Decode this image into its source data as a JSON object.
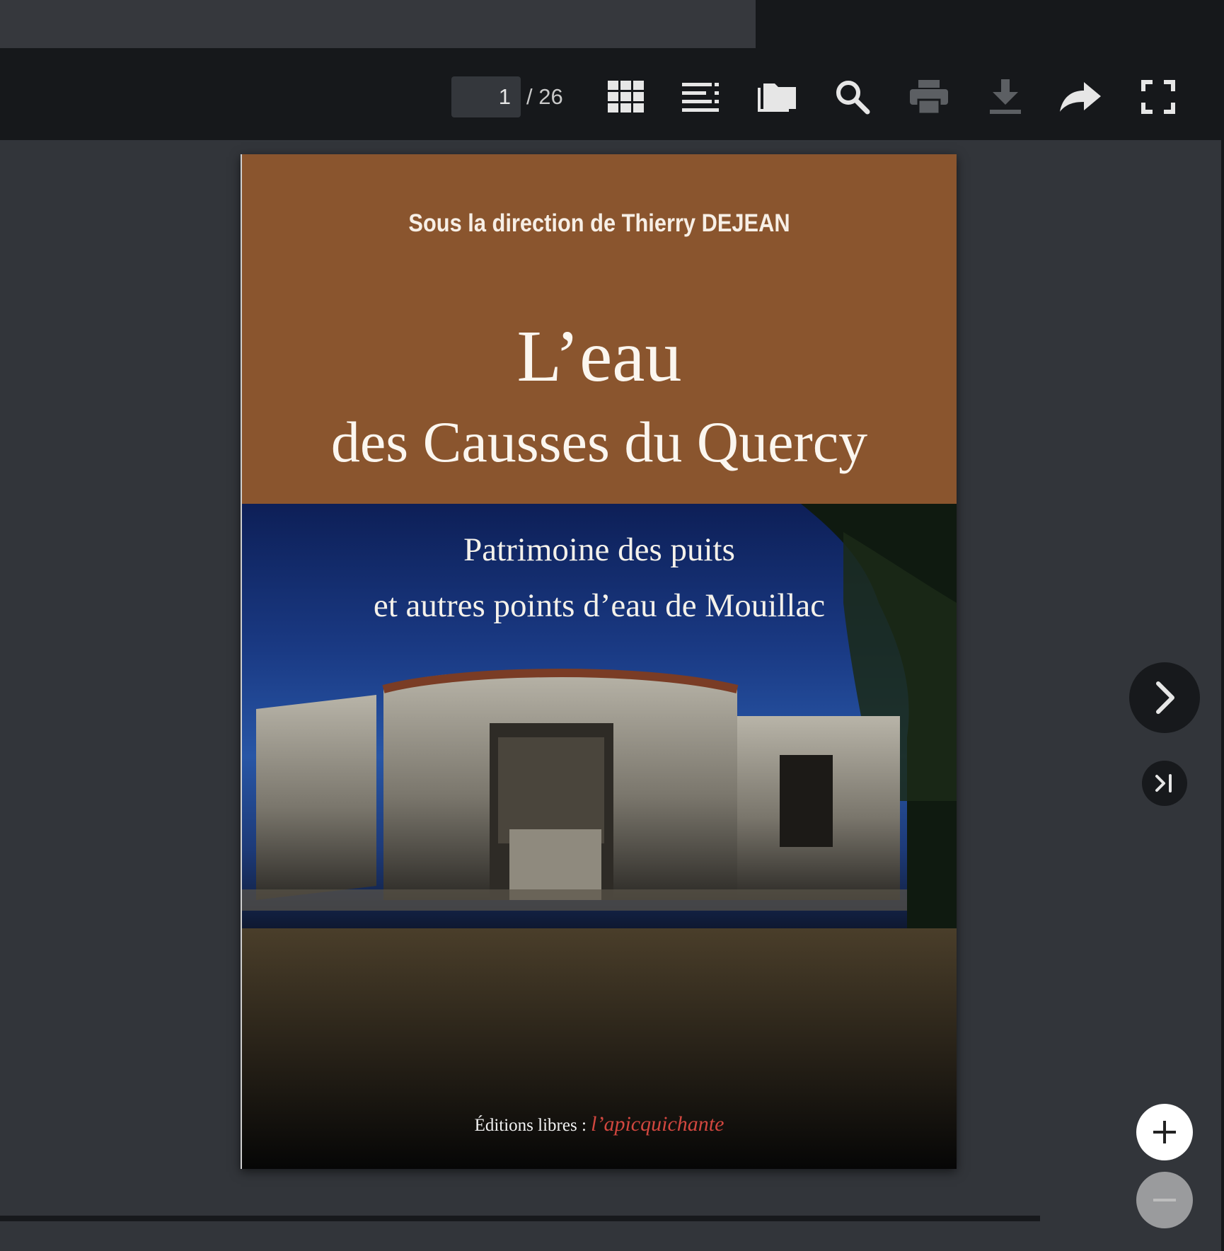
{
  "toolbar": {
    "page_current": "1",
    "page_total": "/ 26",
    "buttons": [
      "thumbnails-icon",
      "outline-icon",
      "attachments-icon",
      "search-icon",
      "print-icon",
      "download-icon",
      "share-icon",
      "fullscreen-icon"
    ]
  },
  "cover": {
    "author": "Sous la direction de Thierry DEJEAN",
    "title_line1": "L’eau",
    "title_line2": "des Causses du Quercy",
    "subtitle_line1": "Patrimoine des puits",
    "subtitle_line2": "et autres points d’eau de Mouillac",
    "publisher_prefix": "Éditions libres :",
    "publisher_name": "l’apicquichante",
    "band_color": "#8a552e"
  },
  "navigation": {
    "next_icon": "chevron-right-icon",
    "last_icon": "last-page-icon",
    "zoom_in_icon": "plus-icon",
    "zoom_out_icon": "minus-icon"
  }
}
